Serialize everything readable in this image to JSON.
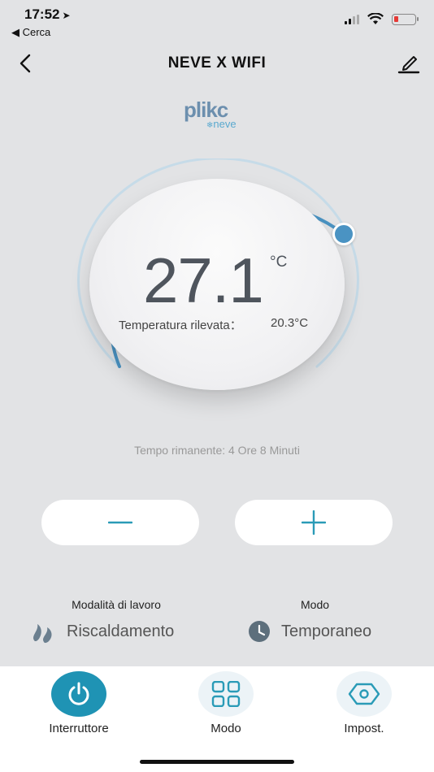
{
  "status": {
    "time": "17:52",
    "back_label": "◀ Cerca"
  },
  "nav": {
    "title": "NEVE X WIFI"
  },
  "logo": {
    "main": "plikc",
    "sub": "neve"
  },
  "thermostat": {
    "set_temp": "27.1",
    "unit": "°C",
    "measured_label": "Temperatura rilevata：",
    "measured_value": "20.3°C",
    "remaining": "Tempo rimanente: 4 Ore 8 Minuti"
  },
  "controls": {
    "minus_icon": "minus-icon",
    "plus_icon": "plus-icon"
  },
  "work_mode": {
    "title": "Modalità di lavoro",
    "value": "Riscaldamento",
    "icon": "flame-icon"
  },
  "mode": {
    "title": "Modo",
    "value": "Temporaneo",
    "icon": "clock-icon"
  },
  "tabs": [
    {
      "label": "Interruttore",
      "icon": "power-icon",
      "active": true
    },
    {
      "label": "Modo",
      "icon": "grid-icon",
      "active": false
    },
    {
      "label": "Impost.",
      "icon": "settings-icon",
      "active": false
    }
  ],
  "colors": {
    "accent": "#4a93c3",
    "teal": "#2a9bb7",
    "tab_active_bg": "#1f93b4",
    "tab_inactive_bg": "#ecf3f7",
    "background": "#e2e3e5"
  }
}
